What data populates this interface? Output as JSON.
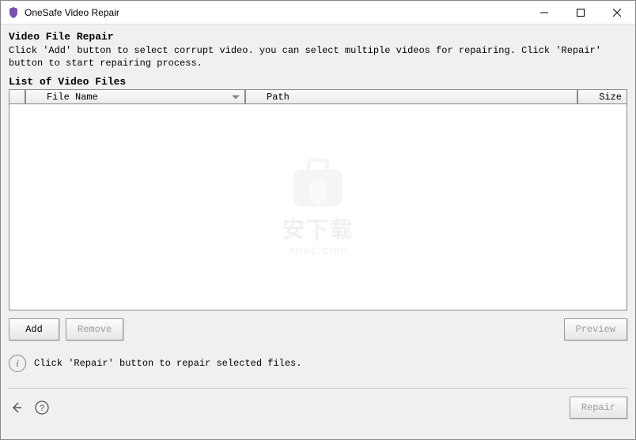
{
  "window": {
    "title": "OneSafe Video Repair"
  },
  "header": {
    "heading": "Video File Repair",
    "instructions": "Click 'Add' button to select corrupt video. you can select multiple videos for repairing. Click 'Repair' button to start repairing process."
  },
  "list": {
    "title": "List of Video Files",
    "columns": {
      "filename": "File Name",
      "path": "Path",
      "size": "Size"
    },
    "rows": []
  },
  "buttons": {
    "add": "Add",
    "remove": "Remove",
    "preview": "Preview",
    "repair": "Repair"
  },
  "hint": {
    "text": "Click 'Repair' button to repair selected files."
  },
  "watermark": {
    "text": "安下载",
    "sub": "anxz.com"
  }
}
